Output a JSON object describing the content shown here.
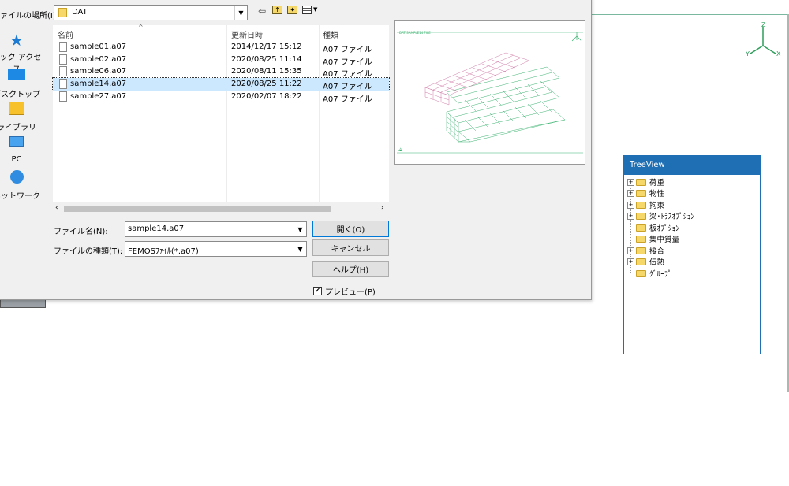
{
  "dialog": {
    "look_in_label": "ァイルの場所(I):",
    "look_in_value": "DAT",
    "toolbar_icons": [
      "back-arrow-icon",
      "up-folder-icon",
      "new-folder-icon",
      "view-menu-icon"
    ],
    "places": [
      {
        "label": "イック アクセス",
        "icon": "quick-access-star-icon"
      },
      {
        "label": "デスクトップ",
        "icon": "desktop-icon"
      },
      {
        "label": "ライブラリ",
        "icon": "library-icon"
      },
      {
        "label": "PC",
        "icon": "pc-icon"
      },
      {
        "label": "ネットワーク",
        "icon": "network-icon"
      }
    ],
    "columns": {
      "name": "名前",
      "date": "更新日時",
      "type": "種類"
    },
    "files": [
      {
        "name": "sample01.a07",
        "date": "2014/12/17 15:12",
        "type": "A07 ファイル",
        "selected": false
      },
      {
        "name": "sample02.a07",
        "date": "2020/08/25 11:14",
        "type": "A07 ファイル",
        "selected": false
      },
      {
        "name": "sample06.a07",
        "date": "2020/08/11 15:35",
        "type": "A07 ファイル",
        "selected": false
      },
      {
        "name": "sample14.a07",
        "date": "2020/08/25 11:22",
        "type": "A07 ファイル",
        "selected": true
      },
      {
        "name": "sample27.a07",
        "date": "2020/02/07 18:22",
        "type": "A07 ファイル",
        "selected": false
      }
    ],
    "filename_label": "ファイル名(N):",
    "filename_value": "sample14.a07",
    "filetype_label": "ファイルの種類(T):",
    "filetype_value": "FEMOSﾌｧｲﾙ(*.a07)",
    "open_button": "開く(O)",
    "cancel_button": "キャンセル",
    "help_button": "ヘルプ(H)",
    "preview_checkbox": "プレビュー(P)",
    "preview_checked": true,
    "preview_caption": "DAT  SAMPLE14  FILE"
  },
  "axes": {
    "z": "Z",
    "y": "Y",
    "x": "X"
  },
  "treeview": {
    "title": "TreeView",
    "items": [
      {
        "label": "荷重",
        "expandable": true
      },
      {
        "label": "物性",
        "expandable": true
      },
      {
        "label": "拘束",
        "expandable": true
      },
      {
        "label": "梁･ﾄﾗｽｵﾌﾟｼｮﾝ",
        "expandable": true
      },
      {
        "label": "板ｵﾌﾟｼｮﾝ",
        "expandable": false
      },
      {
        "label": "集中質量",
        "expandable": false
      },
      {
        "label": "接合",
        "expandable": true
      },
      {
        "label": "伝熱",
        "expandable": true
      },
      {
        "label": "ｸﾞﾙｰﾌﾟ",
        "expandable": false
      }
    ]
  },
  "colors": {
    "accent": "#0078d7",
    "treeview_title": "#1f6fb5",
    "selection": "#cce8ff",
    "mesh_pink": "#d07aa6",
    "mesh_green": "#3cb371"
  }
}
